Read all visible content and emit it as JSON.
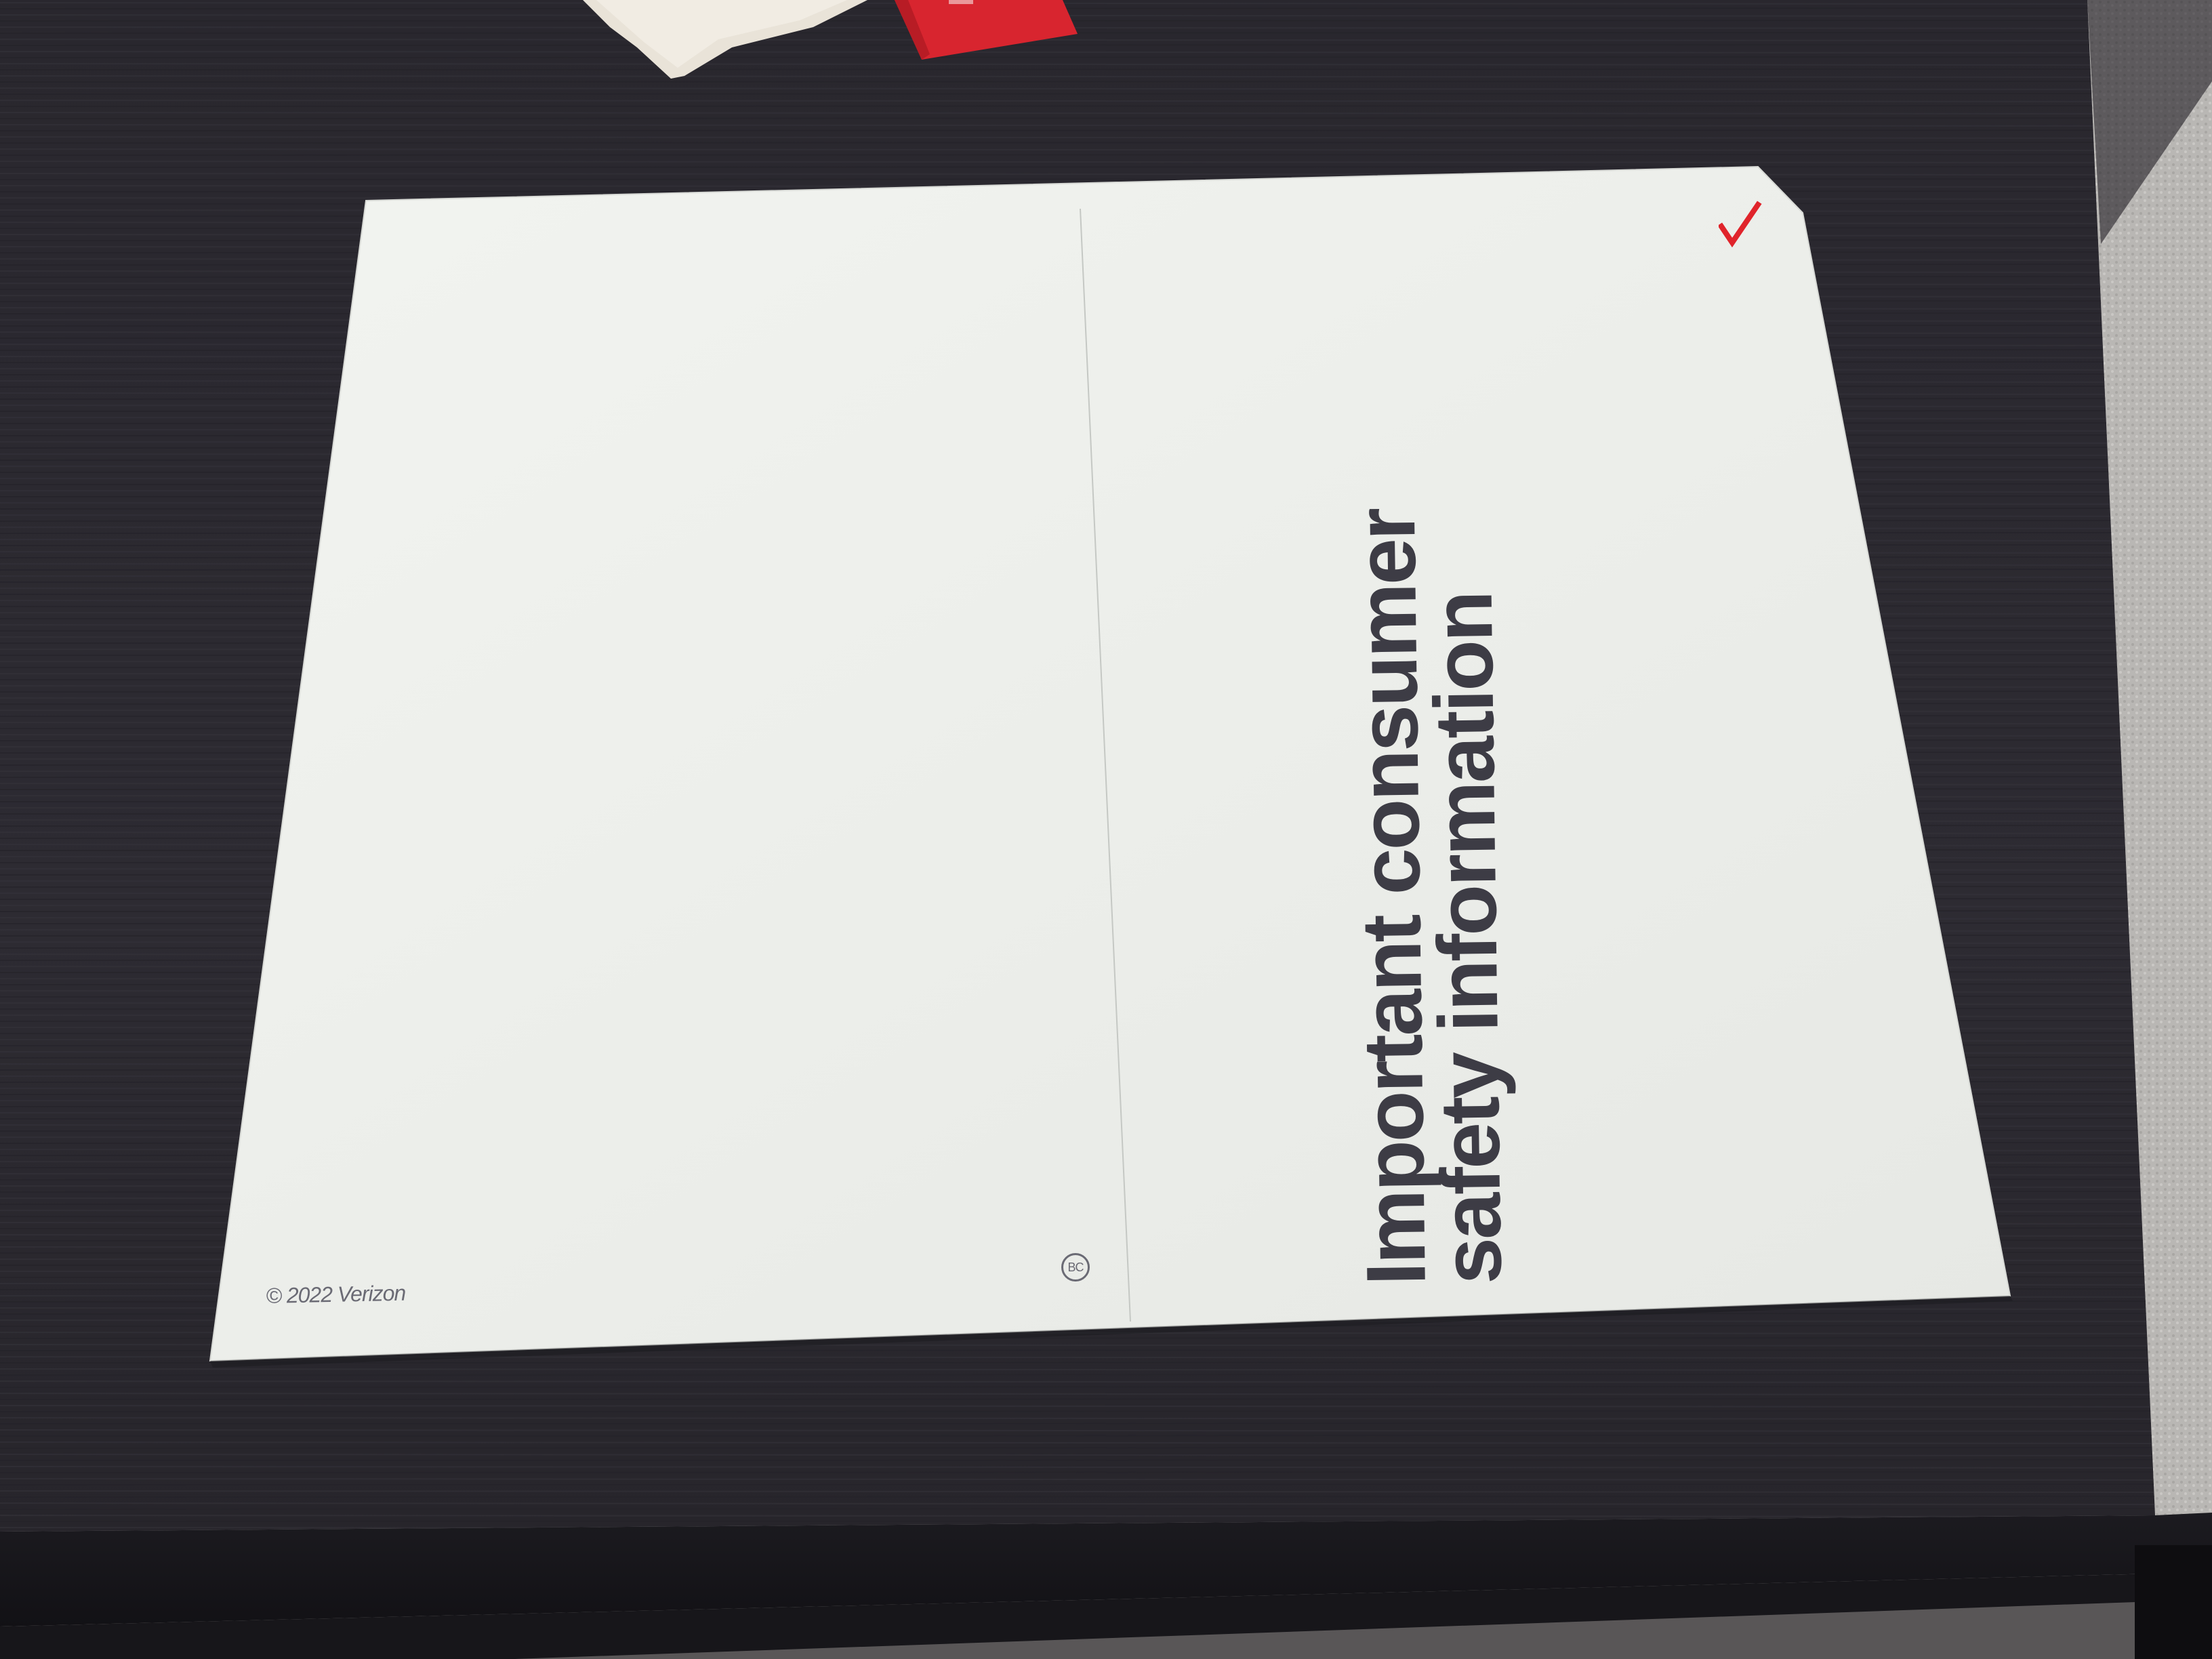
{
  "scene": {
    "description_colors": {
      "table": "#2b2930",
      "paper": "#eef0ec",
      "text_dark": "#3d3c45",
      "text_gray": "#6a6a74",
      "brand_red": "#e0242b",
      "floor": "#bdbbb8"
    }
  },
  "leaflet": {
    "title_line_1": "Important consumer",
    "title_line_2": "safety information",
    "copyright": "© 2022 Verizon",
    "bc_symbol": "BC",
    "logo": "verizon-checkmark-icon"
  }
}
